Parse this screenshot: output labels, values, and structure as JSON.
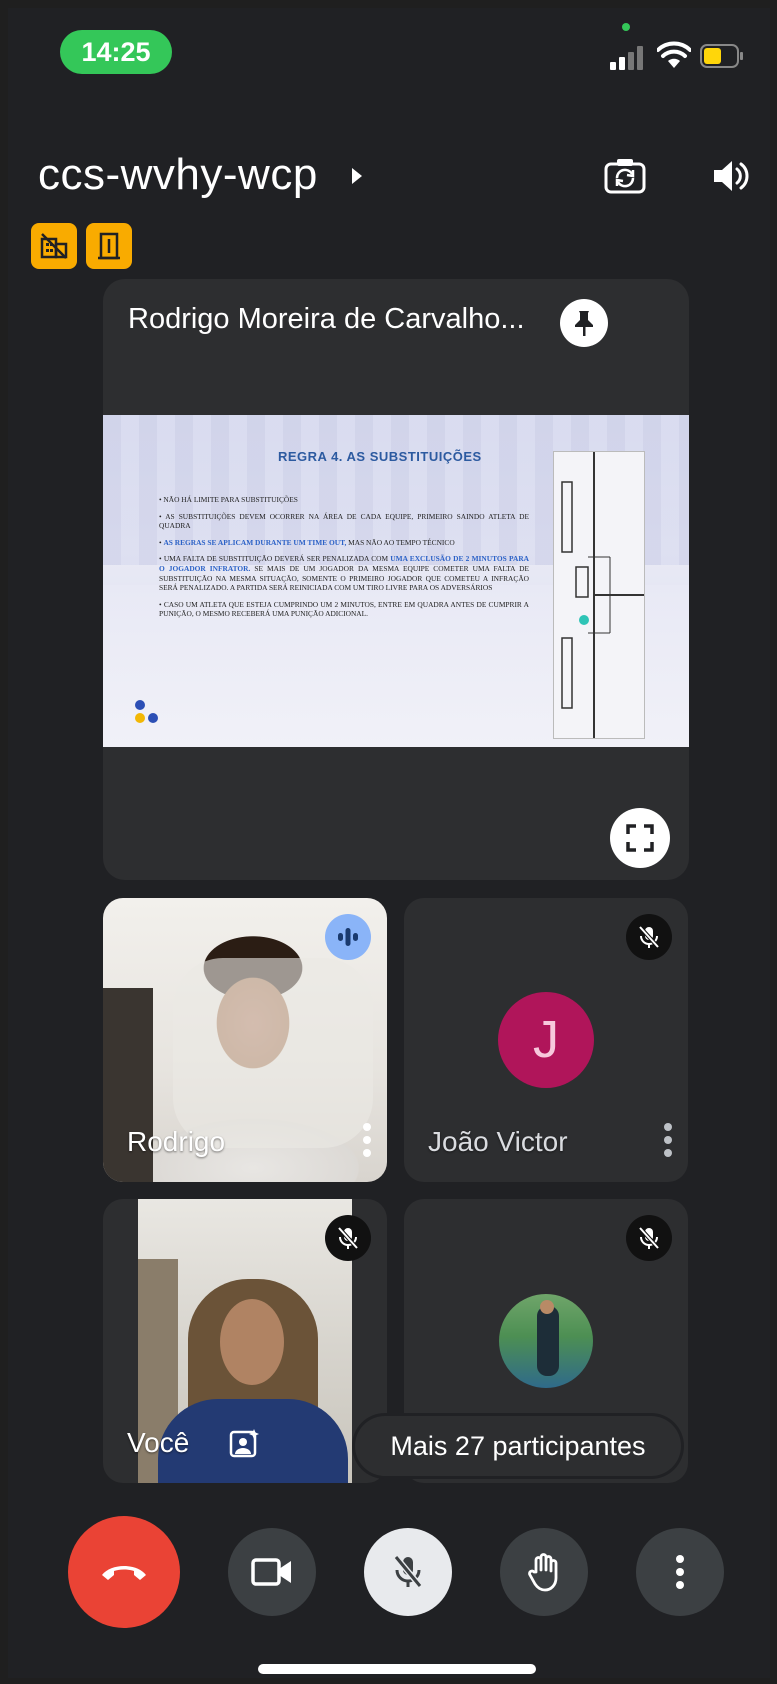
{
  "status_bar": {
    "time": "14:25"
  },
  "header": {
    "meeting_code": "ccs-wvhy-wcp"
  },
  "presentation": {
    "presenter_name": "Rodrigo Moreira de Carvalho...",
    "slide": {
      "title": "REGRA 4.  AS SUBSTITUIÇÕES",
      "bullets": [
        {
          "pre": "• NÃO  HÁ LIMITE PARA SUBSTITUIÇÕES",
          "hl": "",
          "post": ""
        },
        {
          "pre": "• AS SUBSTITUIÇÕES DEVEM OCORRER NA ÁREA DE CADA EQUIPE, PRIMEIRO SAINDO ATLETA DE QUADRA",
          "hl": "",
          "post": ""
        },
        {
          "pre": "• ",
          "hl": "AS REGRAS SE APLICAM DURANTE UM TIME OUT,",
          "post": " MAS NÃO AO TEMPO TÉCNICO"
        },
        {
          "pre": "• UMA FALTA DE SUBSTITUIÇÃO DEVERÁ SER PENALIZADA COM ",
          "hl": "UMA EXCLUSÃO DE 2 MINUTOS PARA O JOGADOR INFRATOR.",
          "post": " SE MAIS DE UM JOGADOR DA MESMA EQUIPE COMETER UMA FALTA DE SUBSTITUIÇÃO NA MESMA SITUAÇÃO, SOMENTE O PRIMEIRO JOGADOR QUE COMETEU A INFRAÇÃO SERÁ PENALIZADO. A PARTIDA SERÁ REINICIADA COM UM TIRO LIVRE PARA OS ADVERSÁRIOS"
        },
        {
          "pre": "• CASO UM ATLETA QUE ESTEJA CUMPRINDO UM 2 MINUTOS, ENTRE EM QUADRA ANTES DE CUMPRIR A PUNIÇÃO, O MESMO RECEBERÁ UMA PUNIÇÃO ADICIONAL.",
          "hl": "",
          "post": ""
        }
      ]
    }
  },
  "participants": [
    {
      "name": "Rodrigo",
      "state": "speaking"
    },
    {
      "name": "João Victor",
      "state": "muted",
      "avatar_letter": "J",
      "avatar_color": "#b0155a"
    },
    {
      "name": "Você",
      "state": "muted"
    },
    {
      "name": "",
      "state": "muted"
    }
  ],
  "more_participants_label": "Mais 27 participantes",
  "colors": {
    "end_call": "#ea4335",
    "time_pill": "#34c759",
    "badge": "#f9ab00",
    "speaking": "#8ab4f8"
  },
  "icons": {
    "end_call": "phone-hangup-icon",
    "camera": "video-camera-icon",
    "mic": "mic-off-icon",
    "hand": "raise-hand-icon",
    "more": "more-vertical-icon",
    "camera_switch": "camera-switch-icon",
    "speaker": "speaker-icon",
    "pin": "pin-icon",
    "fullscreen": "fullscreen-icon"
  }
}
